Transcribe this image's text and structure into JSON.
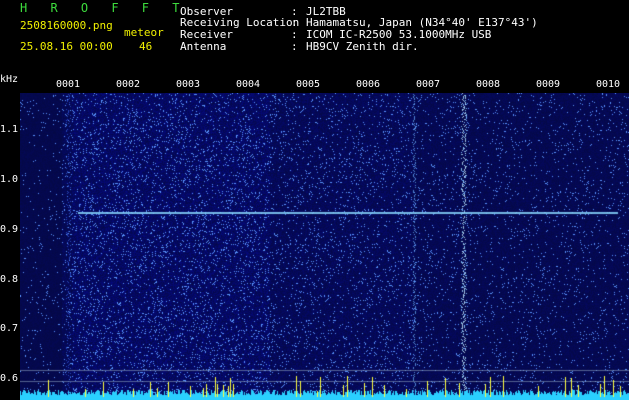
{
  "app": {
    "title": "H R O F F T"
  },
  "file": {
    "name": "2508160000.png",
    "datetime": "25.08.16 00:00"
  },
  "meteor": {
    "label": "meteor",
    "count": "46"
  },
  "header": [
    {
      "label": "Observer",
      "value": "JL2TBB"
    },
    {
      "label": "Receiving Location",
      "value": "Hamamatsu, Japan (N34°40' E137°43')"
    },
    {
      "label": "Receiver",
      "value": "ICOM IC-R2500 53.1000MHz USB"
    },
    {
      "label": "Antenna",
      "value": "HB9CV Zenith dir."
    }
  ],
  "separator": ":",
  "y_axis": {
    "unit": "kHz",
    "ticks": [
      "1.1",
      "1.0",
      "0.9",
      "0.8",
      "0.7",
      "0.6"
    ]
  },
  "x_axis": {
    "ticks": [
      "0001",
      "0002",
      "0003",
      "0004",
      "0005",
      "0006",
      "0007",
      "0008",
      "0009",
      "0010"
    ]
  },
  "colors": {
    "background": "#000000",
    "title": "#3ddc3d",
    "text": "#ffffff",
    "meteor_label": "#f0f000",
    "noise_base": "#0a0f7a",
    "trace": "#8ad8ff",
    "bottom_trace": "#2ad0ff",
    "bottom_spike": "#ffff40"
  }
}
